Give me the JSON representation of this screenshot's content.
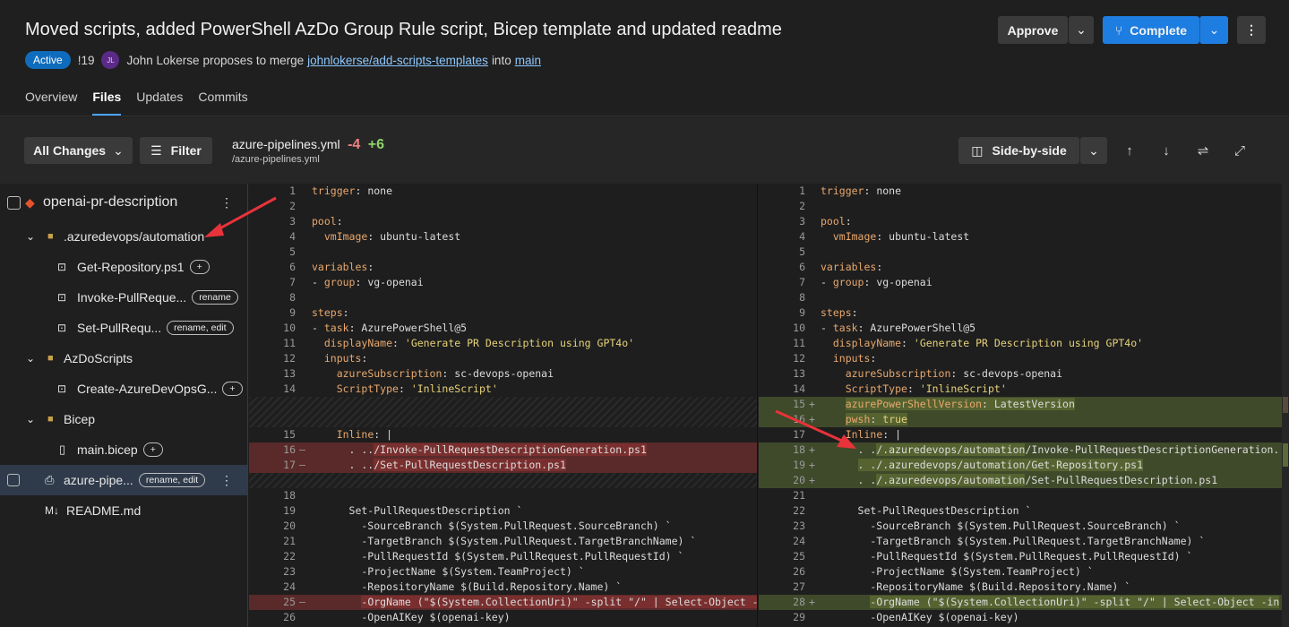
{
  "pr": {
    "title": "Moved scripts, added PowerShell AzDo Group Rule script, Bicep template and updated readme",
    "status": "Active",
    "id": "!19",
    "avatar": "JL",
    "author": "John Lokerse",
    "proposes": "proposes to merge",
    "source_branch": "johnlokerse/add-scripts-templates",
    "into": "into",
    "target_branch": "main"
  },
  "tabs": [
    "Overview",
    "Files",
    "Updates",
    "Commits"
  ],
  "actions": {
    "approve": "Approve",
    "complete": "Complete"
  },
  "toolbar": {
    "all_changes": "All Changes",
    "filter": "Filter",
    "file_name": "azure-pipelines.yml",
    "removed": "-4",
    "added": "+6",
    "file_path": "/azure-pipelines.yml",
    "view_mode": "Side-by-side"
  },
  "tree": {
    "repo": "openai-pr-description",
    "items": [
      {
        "label": ".azuredevops/automation",
        "type": "folder"
      },
      {
        "label": "Get-Repository.ps1",
        "badge": "+",
        "type": "script"
      },
      {
        "label": "Invoke-PullReque...",
        "badge": "rename",
        "type": "script"
      },
      {
        "label": "Set-PullRequ...",
        "badge": "rename, edit",
        "type": "script"
      },
      {
        "label": "AzDoScripts",
        "type": "folder"
      },
      {
        "label": "Create-AzureDevOpsG...",
        "badge": "+",
        "type": "script"
      },
      {
        "label": "Bicep",
        "type": "folder"
      },
      {
        "label": "main.bicep",
        "badge": "+",
        "type": "file"
      },
      {
        "label": "azure-pipe...",
        "badge": "rename, edit",
        "type": "pipeline"
      },
      {
        "label": "README.md",
        "type": "markdown"
      }
    ]
  },
  "left_lines": [
    {
      "n": "1",
      "t": "ctx",
      "c": "<span class='k'>trigger</span>: none"
    },
    {
      "n": "2",
      "t": "ctx",
      "c": ""
    },
    {
      "n": "3",
      "t": "ctx",
      "c": "<span class='k'>pool</span>:"
    },
    {
      "n": "4",
      "t": "ctx",
      "c": "  <span class='k'>vmImage</span>: ubuntu-latest"
    },
    {
      "n": "5",
      "t": "ctx",
      "c": ""
    },
    {
      "n": "6",
      "t": "ctx",
      "c": "<span class='k'>variables</span>:"
    },
    {
      "n": "7",
      "t": "ctx",
      "c": "- <span class='k'>group</span>: vg-openai"
    },
    {
      "n": "8",
      "t": "ctx",
      "c": ""
    },
    {
      "n": "9",
      "t": "ctx",
      "c": "<span class='k'>steps</span>:"
    },
    {
      "n": "10",
      "t": "ctx",
      "c": "- <span class='k'>task</span>: AzurePowerShell@5"
    },
    {
      "n": "11",
      "t": "ctx",
      "c": "  <span class='k'>displayName</span>: <span class='s'>'Generate PR Description using GPT4o'</span>"
    },
    {
      "n": "12",
      "t": "ctx",
      "c": "  <span class='k'>inputs</span>:"
    },
    {
      "n": "13",
      "t": "ctx",
      "c": "    <span class='k'>azureSubscription</span>: sc-devops-openai"
    },
    {
      "n": "14",
      "t": "ctx",
      "c": "    <span class='k'>ScriptType</span>: <span class='s'>'InlineScript'</span>"
    },
    {
      "n": "",
      "t": "hatch",
      "c": ""
    },
    {
      "n": "",
      "t": "hatch",
      "c": ""
    },
    {
      "n": "15",
      "t": "ctx",
      "c": "    <span class='k'>Inline</span>: |"
    },
    {
      "n": "16",
      "t": "del",
      "m": "—",
      "c": "      . ..<span class='hl'>/Invoke-PullRequestDescriptionGeneration.ps1</span>"
    },
    {
      "n": "17",
      "t": "del",
      "m": "—",
      "c": "      . ..<span class='hl'>/Set-PullRequestDescription.ps1</span>"
    },
    {
      "n": "",
      "t": "hatch",
      "c": ""
    },
    {
      "n": "18",
      "t": "ctx",
      "c": ""
    },
    {
      "n": "19",
      "t": "ctx",
      "c": "      Set-PullRequestDescription `"
    },
    {
      "n": "20",
      "t": "ctx",
      "c": "        -SourceBranch $(System.PullRequest.SourceBranch) `"
    },
    {
      "n": "21",
      "t": "ctx",
      "c": "        -TargetBranch $(System.PullRequest.TargetBranchName) `"
    },
    {
      "n": "22",
      "t": "ctx",
      "c": "        -PullRequestId $(System.PullRequest.PullRequestId) `"
    },
    {
      "n": "23",
      "t": "ctx",
      "c": "        -ProjectName $(System.TeamProject) `"
    },
    {
      "n": "24",
      "t": "ctx",
      "c": "        -RepositoryName $(Build.Repository.Name) `"
    },
    {
      "n": "25",
      "t": "del",
      "m": "—",
      "c": "        <span class='hl'>-OrgName (\"$(System.CollectionUri)\" -split \"/\" | Select-Object -in</span>"
    },
    {
      "n": "26",
      "t": "ctx",
      "c": "        -OpenAIKey $(openai-key)"
    }
  ],
  "right_lines": [
    {
      "n": "1",
      "t": "ctx",
      "c": "<span class='k'>trigger</span>: none"
    },
    {
      "n": "2",
      "t": "ctx",
      "c": ""
    },
    {
      "n": "3",
      "t": "ctx",
      "c": "<span class='k'>pool</span>:"
    },
    {
      "n": "4",
      "t": "ctx",
      "c": "  <span class='k'>vmImage</span>: ubuntu-latest"
    },
    {
      "n": "5",
      "t": "ctx",
      "c": ""
    },
    {
      "n": "6",
      "t": "ctx",
      "c": "<span class='k'>variables</span>:"
    },
    {
      "n": "7",
      "t": "ctx",
      "c": "- <span class='k'>group</span>: vg-openai"
    },
    {
      "n": "8",
      "t": "ctx",
      "c": ""
    },
    {
      "n": "9",
      "t": "ctx",
      "c": "<span class='k'>steps</span>:"
    },
    {
      "n": "10",
      "t": "ctx",
      "c": "- <span class='k'>task</span>: AzurePowerShell@5"
    },
    {
      "n": "11",
      "t": "ctx",
      "c": "  <span class='k'>displayName</span>: <span class='s'>'Generate PR Description using GPT4o'</span>"
    },
    {
      "n": "12",
      "t": "ctx",
      "c": "  <span class='k'>inputs</span>:"
    },
    {
      "n": "13",
      "t": "ctx",
      "c": "    <span class='k'>azureSubscription</span>: sc-devops-openai"
    },
    {
      "n": "14",
      "t": "ctx",
      "c": "    <span class='k'>ScriptType</span>: <span class='s'>'InlineScript'</span>"
    },
    {
      "n": "15",
      "t": "add",
      "m": "+",
      "c": "    <span class='hl'><span class='k'>azurePowerShellVersion</span>: LatestVersion</span>"
    },
    {
      "n": "16",
      "t": "add",
      "m": "+",
      "c": "    <span class='hl'><span class='k'>pwsh</span>: <span class='s'>true</span></span>"
    },
    {
      "n": "17",
      "t": "ctx",
      "c": "    <span class='k'>Inline</span>: |"
    },
    {
      "n": "18",
      "t": "add",
      "m": "+",
      "c": "      . .<span class='hl'>/.azuredevops/automation</span>/Invoke-PullRequestDescriptionGeneration."
    },
    {
      "n": "19",
      "t": "add",
      "m": "+",
      "c": "      <span class='hl'>. ./.azuredevops/automation/Get-Repository.ps1</span>"
    },
    {
      "n": "20",
      "t": "add",
      "m": "+",
      "c": "      . .<span class='hl'>/.azuredevops/automation</span>/Set-PullRequestDescription.ps1"
    },
    {
      "n": "21",
      "t": "ctx",
      "c": ""
    },
    {
      "n": "22",
      "t": "ctx",
      "c": "      Set-PullRequestDescription `"
    },
    {
      "n": "23",
      "t": "ctx",
      "c": "        -SourceBranch $(System.PullRequest.SourceBranch) `"
    },
    {
      "n": "24",
      "t": "ctx",
      "c": "        -TargetBranch $(System.PullRequest.TargetBranchName) `"
    },
    {
      "n": "25",
      "t": "ctx",
      "c": "        -PullRequestId $(System.PullRequest.PullRequestId) `"
    },
    {
      "n": "26",
      "t": "ctx",
      "c": "        -ProjectName $(System.TeamProject) `"
    },
    {
      "n": "27",
      "t": "ctx",
      "c": "        -RepositoryName $(Build.Repository.Name) `"
    },
    {
      "n": "28",
      "t": "add",
      "m": "+",
      "c": "        <span class='hl'>-OrgName (\"$(System.CollectionUri)\" -split \"/\" | Select-Object -in</span>"
    },
    {
      "n": "29",
      "t": "ctx",
      "c": "        -OpenAIKey $(openai-key)"
    }
  ],
  "colors": {
    "accent": "#1e7de0",
    "deleted": "#5a2a2a",
    "added": "#3f4a2a",
    "annotation": "#e8333a"
  }
}
